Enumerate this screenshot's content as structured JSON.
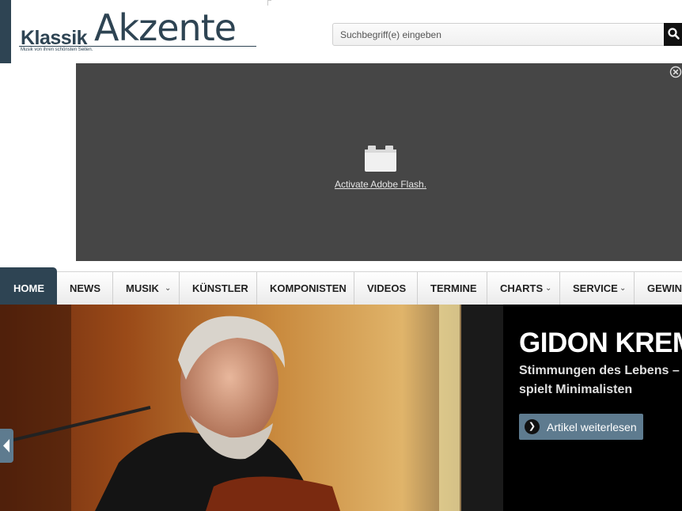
{
  "header": {
    "logo_small": "Klassik",
    "logo_big": "Akzente",
    "logo_tagline": "Musik von ihren schönsten Seiten."
  },
  "search": {
    "placeholder": "Suchbegriff(e) eingeben",
    "button_icon": "search-icon"
  },
  "flash_ad": {
    "link_text": "Activate Adobe Flash.",
    "close_icon": "close-circle-icon",
    "plugin_icon": "plugin-brick-icon"
  },
  "nav": {
    "items": [
      {
        "label": "HOME",
        "active": true,
        "dropdown": false
      },
      {
        "label": "NEWS",
        "active": false,
        "dropdown": false
      },
      {
        "label": "MUSIK",
        "active": false,
        "dropdown": true
      },
      {
        "label": "KÜNSTLER",
        "active": false,
        "dropdown": false
      },
      {
        "label": "KOMPONISTEN",
        "active": false,
        "dropdown": false
      },
      {
        "label": "VIDEOS",
        "active": false,
        "dropdown": false
      },
      {
        "label": "TERMINE",
        "active": false,
        "dropdown": false
      },
      {
        "label": "CHARTS",
        "active": false,
        "dropdown": true
      },
      {
        "label": "SERVICE",
        "active": false,
        "dropdown": true
      },
      {
        "label": "GEWINN",
        "active": false,
        "dropdown": false
      }
    ]
  },
  "hero": {
    "title": "GIDON KREM",
    "subtitle_line1": "Stimmungen des Lebens –",
    "subtitle_line2": "spielt Minimalisten",
    "button_label": "Artikel weiterlesen",
    "prev_icon": "arrow-left-icon"
  },
  "colors": {
    "brand": "#2e4453",
    "button": "#5e7b8f",
    "flash_bg": "#464646"
  }
}
